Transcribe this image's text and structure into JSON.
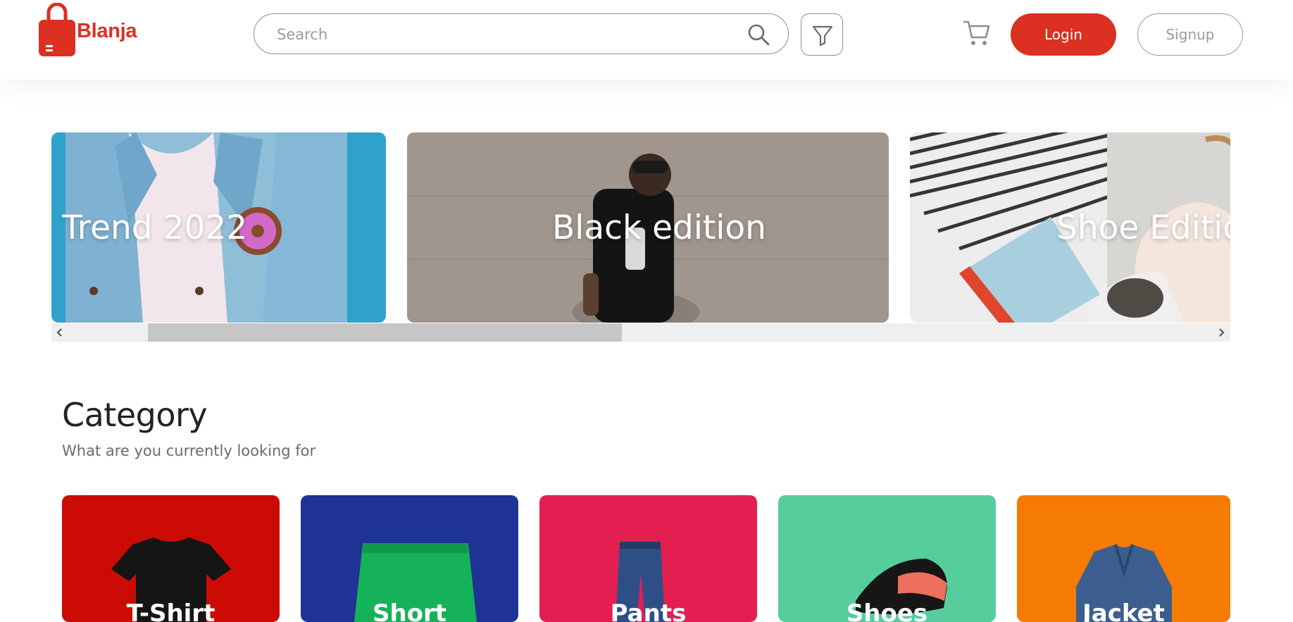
{
  "brand": {
    "name": "Blanja",
    "color": "#DB3022"
  },
  "search": {
    "placeholder": "Search"
  },
  "header": {
    "login_label": "Login",
    "signup_label": "Signup"
  },
  "icons": {
    "logo": "shopping-bag-icon",
    "search": "search-icon",
    "filter": "filter-icon",
    "cart": "cart-icon",
    "scroll_left": "chevron-left-icon",
    "scroll_right": "chevron-right-icon"
  },
  "banners": [
    {
      "title": "Trend 2022"
    },
    {
      "title": "Black edition"
    },
    {
      "title": "Shoe Edition"
    }
  ],
  "category": {
    "title": "Category",
    "subtitle": "What are you currently looking for",
    "items": [
      {
        "label": "T-Shirt",
        "color": "#CC0B04"
      },
      {
        "label": "Short",
        "color": "#1F3394"
      },
      {
        "label": "Pants",
        "color": "#E31F51"
      },
      {
        "label": "Shoes",
        "color": "#57CD9E"
      },
      {
        "label": "Jacket",
        "color": "#F67B02"
      }
    ]
  }
}
